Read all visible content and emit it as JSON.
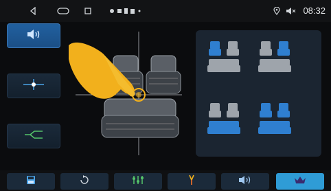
{
  "statusbar": {
    "time": "08:32",
    "icons": [
      "back-icon",
      "home-icon",
      "recents-icon",
      "notification-dots-icon",
      "location-icon",
      "volume-mute-icon"
    ]
  },
  "left_buttons": [
    {
      "name": "speaker-mode-button",
      "icon": "speaker-icon",
      "active": true
    },
    {
      "name": "balance-center-button",
      "icon": "crosshair-icon",
      "active": false
    },
    {
      "name": "crossover-button",
      "icon": "crossover-icon",
      "active": false
    }
  ],
  "presets": [
    {
      "name": "preset-front-left",
      "highlight": "front-left"
    },
    {
      "name": "preset-front-right",
      "highlight": "front-right"
    },
    {
      "name": "preset-rear",
      "highlight": "rear"
    },
    {
      "name": "preset-all",
      "highlight": "all"
    }
  ],
  "bottom_bar": [
    {
      "name": "save-button",
      "icon": "save-icon",
      "active": false
    },
    {
      "name": "reset-button",
      "icon": "reset-icon",
      "active": false
    },
    {
      "name": "equalizer-button",
      "icon": "equalizer-icon",
      "active": false
    },
    {
      "name": "tune-button",
      "icon": "tuning-fork-icon",
      "active": false
    },
    {
      "name": "sound-field-button",
      "icon": "volume-icon",
      "active": false
    },
    {
      "name": "premium-button",
      "icon": "crown-icon",
      "active": true
    }
  ],
  "colors": {
    "accent": "#2f9cd6",
    "seat_highlight": "#2f7fd0",
    "pointer": "#f2b01c"
  }
}
